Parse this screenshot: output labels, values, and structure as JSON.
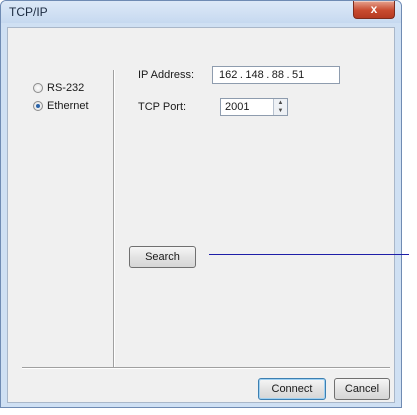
{
  "window": {
    "title": "TCP/IP",
    "close_glyph": "x"
  },
  "connection": {
    "options": [
      {
        "label": "RS-232",
        "checked": false
      },
      {
        "label": "Ethernet",
        "checked": true
      }
    ]
  },
  "ip": {
    "label": "IP Address:",
    "octets": [
      "162",
      "148",
      "88",
      "51"
    ]
  },
  "port": {
    "label": "TCP Port:",
    "value": "2001"
  },
  "buttons": {
    "search": "Search",
    "connect": "Connect",
    "cancel": "Cancel"
  }
}
